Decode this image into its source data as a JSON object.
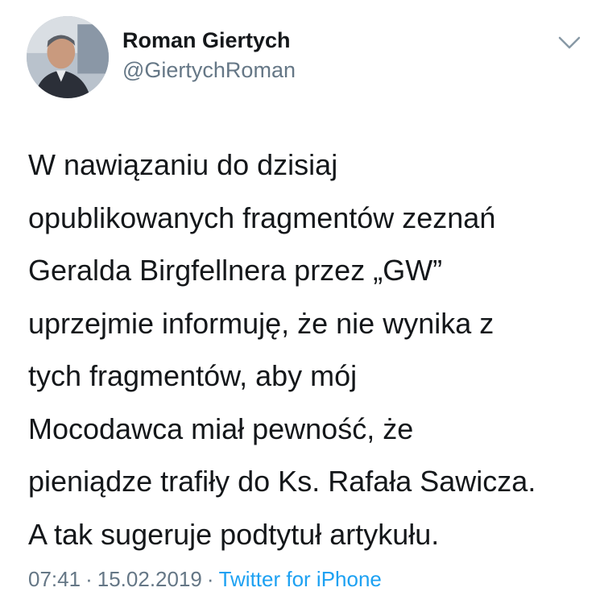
{
  "user": {
    "display_name": "Roman Giertych",
    "handle": "@GiertychRoman"
  },
  "tweet": {
    "lines": [
      "W nawiązaniu do dzisiaj",
      "opublikowanych fragmentów zeznań",
      "Geralda Birgfellnera przez „GW”",
      "uprzejmie informuję, że nie wynika z",
      "tych fragmentów, aby mój",
      "Mocodawca miał pewność, że",
      "pieniądze trafiły do Ks. Rafała Sawicza.",
      "A tak sugeruje podtytuł artykułu."
    ]
  },
  "meta": {
    "time": "07:41",
    "separator": "·",
    "date": "15.02.2019",
    "source": "Twitter for iPhone"
  },
  "icons": {
    "menu": "chevron-down-icon"
  },
  "colors": {
    "text": "#14171a",
    "secondary": "#657786",
    "link": "#1da1f2"
  }
}
